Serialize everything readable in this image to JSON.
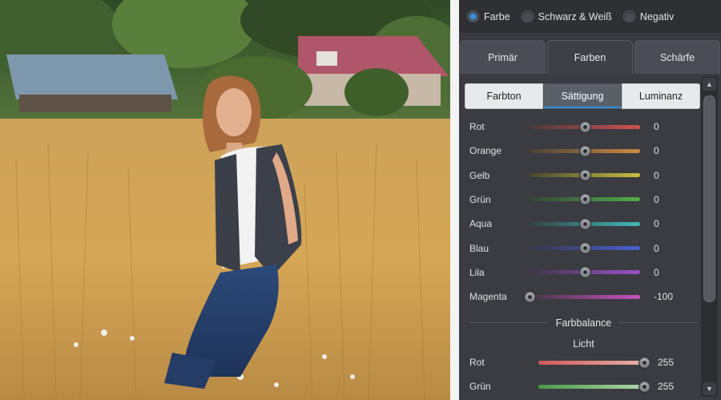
{
  "mode": {
    "options": [
      "Farbe",
      "Schwarz & Weiß",
      "Negativ"
    ],
    "selected": "Farbe"
  },
  "main_tabs": [
    {
      "label": "Primär",
      "active": false
    },
    {
      "label": "Farben",
      "active": true
    },
    {
      "label": "Schärfe",
      "active": false
    }
  ],
  "sub_tabs": [
    {
      "label": "Farbton",
      "active": false
    },
    {
      "label": "Sättigung",
      "active": true
    },
    {
      "label": "Luminanz",
      "active": false
    }
  ],
  "saturation": [
    {
      "label": "Rot",
      "value": 0,
      "min": -100,
      "max": 100,
      "color_a": "#4a3a3a",
      "color_b": "#d05050"
    },
    {
      "label": "Orange",
      "value": 0,
      "min": -100,
      "max": 100,
      "color_a": "#4a4236",
      "color_b": "#d08a40"
    },
    {
      "label": "Gelb",
      "value": 0,
      "min": -100,
      "max": 100,
      "color_a": "#47462f",
      "color_b": "#c8c040"
    },
    {
      "label": "Grün",
      "value": 0,
      "min": -100,
      "max": 100,
      "color_a": "#364436",
      "color_b": "#4fb048"
    },
    {
      "label": "Aqua",
      "value": 0,
      "min": -100,
      "max": 100,
      "color_a": "#344444",
      "color_b": "#40b8b8"
    },
    {
      "label": "Blau",
      "value": 0,
      "min": -100,
      "max": 100,
      "color_a": "#36384a",
      "color_b": "#4a5ed0"
    },
    {
      "label": "Lila",
      "value": 0,
      "min": -100,
      "max": 100,
      "color_a": "#3e3648",
      "color_b": "#9a50c8"
    },
    {
      "label": "Magenta",
      "value": -100,
      "min": -100,
      "max": 100,
      "color_a": "#463646",
      "color_b": "#c850c0"
    }
  ],
  "color_balance": {
    "title": "Farbbalance",
    "subtitle": "Licht",
    "rows": [
      {
        "label": "Rot",
        "value": 255,
        "min": 0,
        "max": 255,
        "color_a": "#d05a5a",
        "color_b": "#e8b0a8"
      },
      {
        "label": "Grün",
        "value": 255,
        "min": 0,
        "max": 255,
        "color_a": "#4a9a4a",
        "color_b": "#b0d8a8"
      }
    ]
  },
  "scroll_up_icon": "triangle-up",
  "scroll_down_icon": "triangle-down"
}
